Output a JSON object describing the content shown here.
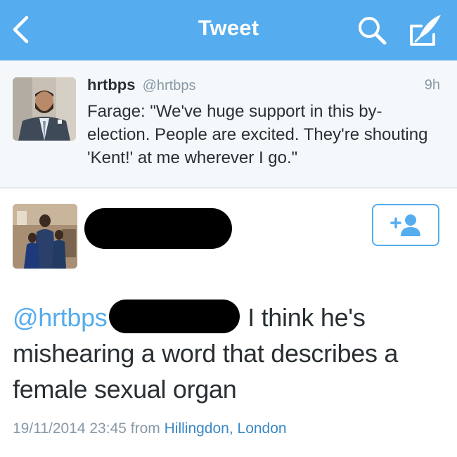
{
  "navbar": {
    "title": "Tweet",
    "background": "#55acee",
    "icons": [
      "chevron-left-icon",
      "search-icon",
      "compose-icon"
    ]
  },
  "parent_tweet": {
    "name": "hrtbps",
    "handle": "@hrtbps",
    "time": "9h",
    "text": "Farage: \"We've huge support in this by-election. People are excited. They're shouting 'Kent!' at me wherever I go.\""
  },
  "main_tweet": {
    "mention": "@hrtbps",
    "text": "I think he's mishearing a word that describes a female sexual organ",
    "date": "19/11/2014 23:45",
    "from_label": "from",
    "location": "Hillingdon, London",
    "follow_icon": "add-user-icon"
  },
  "colors": {
    "accent": "#55acee",
    "text": "#292f33",
    "muted": "#8899a6",
    "link": "#3b88c3"
  }
}
